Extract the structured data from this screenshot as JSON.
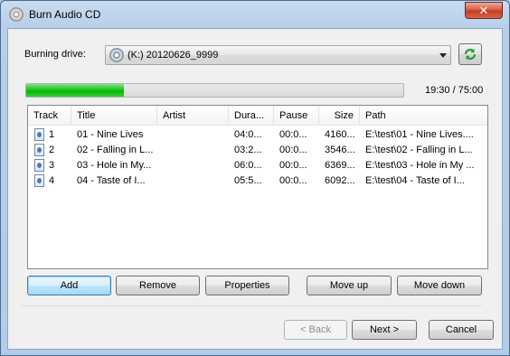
{
  "window": {
    "title": "Burn Audio CD",
    "close_glyph": "✕"
  },
  "drive": {
    "label": "Burning drive:",
    "selected": "(K:) 20120626_9999",
    "icon": "disc-icon",
    "refresh_icon": "refresh-icon"
  },
  "progress": {
    "value_fraction": 0.26,
    "time_text": "19:30 / 75:00",
    "color": "#1fc21f"
  },
  "table": {
    "columns": [
      "Track",
      "Title",
      "Artist",
      "Dura...",
      "Pause",
      "Size",
      "Path"
    ],
    "rows": [
      {
        "track": "1",
        "title": "01 - Nine Lives",
        "artist": "",
        "duration": "04:0...",
        "pause": "00:0...",
        "size": "4160...",
        "path": "E:\\test\\01 - Nine Lives...."
      },
      {
        "track": "2",
        "title": "02 - Falling in L...",
        "artist": "",
        "duration": "03:2...",
        "pause": "00:0...",
        "size": "3546...",
        "path": "E:\\test\\02 - Falling in L..."
      },
      {
        "track": "3",
        "title": "03 - Hole in My...",
        "artist": "",
        "duration": "06:0...",
        "pause": "00:0...",
        "size": "6369...",
        "path": "E:\\test\\03 - Hole in My ..."
      },
      {
        "track": "4",
        "title": "04 - Taste of I...",
        "artist": "",
        "duration": "05:5...",
        "pause": "00:0...",
        "size": "6092...",
        "path": "E:\\test\\04 - Taste of I..."
      }
    ]
  },
  "buttons": {
    "add": "Add",
    "remove": "Remove",
    "properties": "Properties",
    "move_up": "Move up",
    "move_down": "Move down",
    "back": "< Back",
    "next": "Next >",
    "cancel": "Cancel"
  }
}
